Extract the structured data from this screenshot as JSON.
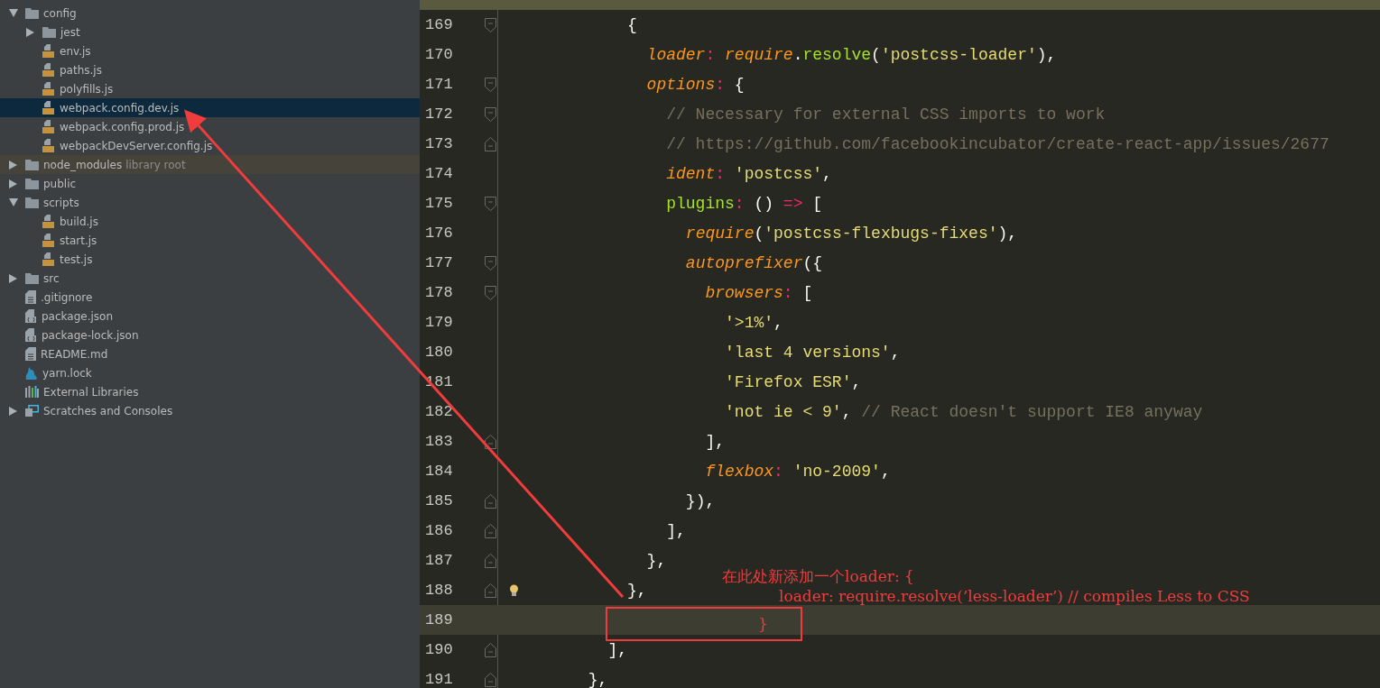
{
  "sidebar": {
    "items": [
      {
        "label": "config",
        "kind": "folder",
        "expanded": true,
        "selected": false,
        "children": [
          {
            "label": "jest",
            "kind": "folder",
            "expanded": false,
            "selected": false
          },
          {
            "label": "env.js",
            "kind": "js",
            "selected": false
          },
          {
            "label": "paths.js",
            "kind": "js",
            "selected": false
          },
          {
            "label": "polyfills.js",
            "kind": "js",
            "selected": false
          },
          {
            "label": "webpack.config.dev.js",
            "kind": "js",
            "selected": true
          },
          {
            "label": "webpack.config.prod.js",
            "kind": "js",
            "selected": false
          },
          {
            "label": "webpackDevServer.config.js",
            "kind": "js",
            "selected": false
          }
        ]
      },
      {
        "label": "node_modules",
        "hint": "library root",
        "kind": "folder",
        "expanded": false,
        "selected": false
      },
      {
        "label": "public",
        "kind": "folder",
        "expanded": false,
        "selected": false
      },
      {
        "label": "scripts",
        "kind": "folder",
        "expanded": true,
        "selected": false,
        "children": [
          {
            "label": "build.js",
            "kind": "js",
            "selected": false
          },
          {
            "label": "start.js",
            "kind": "js",
            "selected": false
          },
          {
            "label": "test.js",
            "kind": "js",
            "selected": false
          }
        ]
      },
      {
        "label": "src",
        "kind": "folder",
        "expanded": false,
        "selected": false
      },
      {
        "label": ".gitignore",
        "kind": "text",
        "selected": false
      },
      {
        "label": "package.json",
        "kind": "json",
        "selected": false
      },
      {
        "label": "package-lock.json",
        "kind": "json",
        "selected": false
      },
      {
        "label": "README.md",
        "kind": "text",
        "selected": false
      },
      {
        "label": "yarn.lock",
        "kind": "yarn",
        "selected": false
      },
      {
        "label": "External Libraries",
        "kind": "libraries",
        "selected": false
      },
      {
        "label": "Scratches and Consoles",
        "kind": "scratches",
        "expanded": false,
        "selected": false
      }
    ]
  },
  "editor": {
    "lines": [
      {
        "children": [
          {
            "children": [
              {
                "number": "169",
                "fold_start": true,
                "fold_end": false,
                "bulb": false,
                "current": false,
                "tokens": [
                  {
                    "kind": "punct",
                    "text": "{"
                  }
                ],
                "children": [
                  {
                    "number": "170",
                    "fold_start": false,
                    "fold_end": false,
                    "bulb": false,
                    "current": false,
                    "tokens": [
                      {
                        "kind": "key",
                        "text": "loader"
                      },
                      {
                        "kind": "op",
                        "text": ": "
                      },
                      {
                        "kind": "key",
                        "text": "require"
                      },
                      {
                        "kind": "punct",
                        "text": "."
                      },
                      {
                        "kind": "fn",
                        "text": "resolve"
                      },
                      {
                        "kind": "punct",
                        "text": "("
                      },
                      {
                        "kind": "str",
                        "text": "'postcss-loader'"
                      },
                      {
                        "kind": "punct",
                        "text": "),"
                      }
                    ]
                  },
                  {
                    "number": "171",
                    "fold_start": true,
                    "fold_end": false,
                    "bulb": false,
                    "current": false,
                    "tokens": [
                      {
                        "kind": "key",
                        "text": "options"
                      },
                      {
                        "kind": "op",
                        "text": ": "
                      },
                      {
                        "kind": "punct",
                        "text": "{"
                      }
                    ],
                    "children": [
                      {
                        "number": "172",
                        "fold_start": true,
                        "fold_end": false,
                        "bulb": false,
                        "current": false,
                        "tokens": [
                          {
                            "kind": "comment",
                            "text": "// Necessary for external CSS imports to work"
                          }
                        ]
                      },
                      {
                        "number": "173",
                        "fold_start": false,
                        "fold_end": true,
                        "bulb": false,
                        "current": false,
                        "tokens": [
                          {
                            "kind": "comment",
                            "text": "// https://github.com/facebookincubator/create-react-app/issues/2677"
                          }
                        ]
                      },
                      {
                        "number": "174",
                        "fold_start": false,
                        "fold_end": false,
                        "bulb": false,
                        "current": false,
                        "tokens": [
                          {
                            "kind": "key",
                            "text": "ident"
                          },
                          {
                            "kind": "op",
                            "text": ": "
                          },
                          {
                            "kind": "str",
                            "text": "'postcss'"
                          },
                          {
                            "kind": "punct",
                            "text": ","
                          }
                        ]
                      },
                      {
                        "number": "175",
                        "fold_start": true,
                        "fold_end": false,
                        "bulb": false,
                        "current": false,
                        "tokens": [
                          {
                            "kind": "fn",
                            "text": "plugins"
                          },
                          {
                            "kind": "op",
                            "text": ": "
                          },
                          {
                            "kind": "punct",
                            "text": "() "
                          },
                          {
                            "kind": "op",
                            "text": "=>"
                          },
                          {
                            "kind": "punct",
                            "text": " ["
                          }
                        ],
                        "children": [
                          {
                            "number": "176",
                            "fold_start": false,
                            "fold_end": false,
                            "bulb": false,
                            "current": false,
                            "tokens": [
                              {
                                "kind": "key",
                                "text": "require"
                              },
                              {
                                "kind": "punct",
                                "text": "("
                              },
                              {
                                "kind": "str",
                                "text": "'postcss-flexbugs-fixes'"
                              },
                              {
                                "kind": "punct",
                                "text": "),"
                              }
                            ]
                          },
                          {
                            "number": "177",
                            "fold_start": true,
                            "fold_end": false,
                            "bulb": false,
                            "current": false,
                            "tokens": [
                              {
                                "kind": "key",
                                "text": "autoprefixer"
                              },
                              {
                                "kind": "punct",
                                "text": "({"
                              }
                            ],
                            "children": [
                              {
                                "number": "178",
                                "fold_start": true,
                                "fold_end": false,
                                "bulb": false,
                                "current": false,
                                "tokens": [
                                  {
                                    "kind": "key",
                                    "text": "browsers"
                                  },
                                  {
                                    "kind": "op",
                                    "text": ": "
                                  },
                                  {
                                    "kind": "punct",
                                    "text": "["
                                  }
                                ],
                                "children": [
                                  {
                                    "number": "179",
                                    "fold_start": false,
                                    "fold_end": false,
                                    "bulb": false,
                                    "current": false,
                                    "tokens": [
                                      {
                                        "kind": "str",
                                        "text": "'>1%'"
                                      },
                                      {
                                        "kind": "punct",
                                        "text": ","
                                      }
                                    ]
                                  },
                                  {
                                    "number": "180",
                                    "fold_start": false,
                                    "fold_end": false,
                                    "bulb": false,
                                    "current": false,
                                    "tokens": [
                                      {
                                        "kind": "str",
                                        "text": "'last 4 versions'"
                                      },
                                      {
                                        "kind": "punct",
                                        "text": ","
                                      }
                                    ]
                                  },
                                  {
                                    "number": "181",
                                    "fold_start": false,
                                    "fold_end": false,
                                    "bulb": false,
                                    "current": false,
                                    "tokens": [
                                      {
                                        "kind": "str",
                                        "text": "'Firefox ESR'"
                                      },
                                      {
                                        "kind": "punct",
                                        "text": ","
                                      }
                                    ]
                                  },
                                  {
                                    "number": "182",
                                    "fold_start": false,
                                    "fold_end": false,
                                    "bulb": false,
                                    "current": false,
                                    "tokens": [
                                      {
                                        "kind": "str",
                                        "text": "'not ie < 9'"
                                      },
                                      {
                                        "kind": "punct",
                                        "text": ", "
                                      },
                                      {
                                        "kind": "comment",
                                        "text": "// React doesn't support IE8 anyway"
                                      }
                                    ]
                                  }
                                ]
                              },
                              {
                                "number": "183",
                                "fold_start": false,
                                "fold_end": true,
                                "bulb": false,
                                "current": false,
                                "tokens": [
                                  {
                                    "kind": "punct",
                                    "text": "],"
                                  }
                                ]
                              },
                              {
                                "number": "184",
                                "fold_start": false,
                                "fold_end": false,
                                "bulb": false,
                                "current": false,
                                "tokens": [
                                  {
                                    "kind": "key",
                                    "text": "flexbox"
                                  },
                                  {
                                    "kind": "op",
                                    "text": ": "
                                  },
                                  {
                                    "kind": "str",
                                    "text": "'no-2009'"
                                  },
                                  {
                                    "kind": "punct",
                                    "text": ","
                                  }
                                ]
                              }
                            ]
                          },
                          {
                            "number": "185",
                            "fold_start": false,
                            "fold_end": true,
                            "bulb": false,
                            "current": false,
                            "tokens": [
                              {
                                "kind": "punct",
                                "text": "}),"
                              }
                            ]
                          }
                        ]
                      },
                      {
                        "number": "186",
                        "fold_start": false,
                        "fold_end": true,
                        "bulb": false,
                        "current": false,
                        "tokens": [
                          {
                            "kind": "punct",
                            "text": "],"
                          }
                        ]
                      }
                    ]
                  },
                  {
                    "number": "187",
                    "fold_start": false,
                    "fold_end": true,
                    "bulb": false,
                    "current": false,
                    "tokens": [
                      {
                        "kind": "punct",
                        "text": "},"
                      }
                    ]
                  }
                ]
              },
              {
                "number": "188",
                "fold_start": false,
                "fold_end": true,
                "bulb": true,
                "current": false,
                "tokens": [
                  {
                    "kind": "punct",
                    "text": "},"
                  }
                ]
              },
              {
                "number": "189",
                "fold_start": false,
                "fold_end": false,
                "bulb": false,
                "current": true
              }
            ]
          },
          {
            "number": "190",
            "fold_start": false,
            "fold_end": true,
            "bulb": false,
            "current": false,
            "tokens": [
              {
                "kind": "punct",
                "text": "],"
              }
            ]
          }
        ]
      },
      {
        "number": "191",
        "fold_start": false,
        "fold_end": true,
        "bulb": false,
        "current": false,
        "tokens": [
          {
            "kind": "punct",
            "text": "},"
          }
        ]
      }
    ]
  },
  "annotation": {
    "note_lines": [
      "在此处新添加一个loader: {",
      "loader: require.resolve(’less-loader’) // compiles Less to CSS",
      "}"
    ]
  }
}
